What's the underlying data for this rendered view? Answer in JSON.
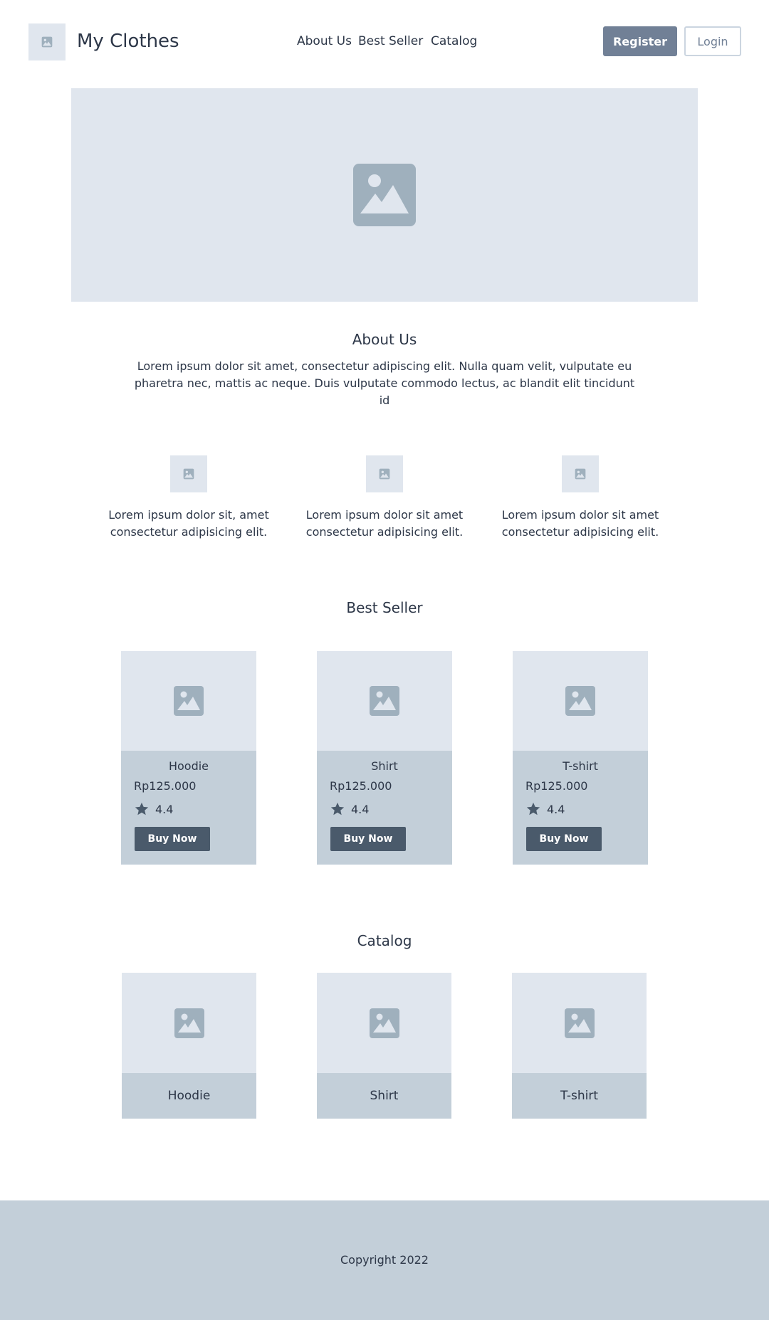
{
  "header": {
    "brand": "My Clothes",
    "nav": [
      "About Us",
      "Best Seller",
      "Catalog"
    ],
    "register_label": "Register",
    "login_label": "Login"
  },
  "about": {
    "title": "About Us",
    "text": "Lorem ipsum dolor sit amet, consectetur adipiscing elit. Nulla quam velit, vulputate eu pharetra nec, mattis ac neque. Duis vulputate commodo lectus, ac blandit elit tincidunt id"
  },
  "features": [
    "Lorem ipsum dolor sit, amet consectetur adipisicing elit.",
    "Lorem ipsum dolor sit amet consectetur adipisicing elit.",
    "Lorem ipsum dolor sit amet consectetur adipisicing elit."
  ],
  "best_seller": {
    "title": "Best Seller",
    "products": [
      {
        "name": "Hoodie",
        "price": "Rp125.000",
        "rating": "4.4",
        "button": "Buy Now"
      },
      {
        "name": "Shirt",
        "price": "Rp125.000",
        "rating": "4.4",
        "button": "Buy Now"
      },
      {
        "name": "T-shirt",
        "price": "Rp125.000",
        "rating": "4.4",
        "button": "Buy Now"
      }
    ]
  },
  "catalog": {
    "title": "Catalog",
    "items": [
      "Hoodie",
      "Shirt",
      "T-shirt"
    ]
  },
  "footer": {
    "copyright": "Copyright 2022"
  },
  "colors": {
    "placeholder_bg": "#e0e6ee",
    "card_bg": "#c3cfd9",
    "register_bg": "#718096",
    "buy_button_bg": "#4a5a6b",
    "text": "#2d3748"
  },
  "icons": {
    "image_placeholder": "image-icon",
    "rating": "star-icon"
  }
}
